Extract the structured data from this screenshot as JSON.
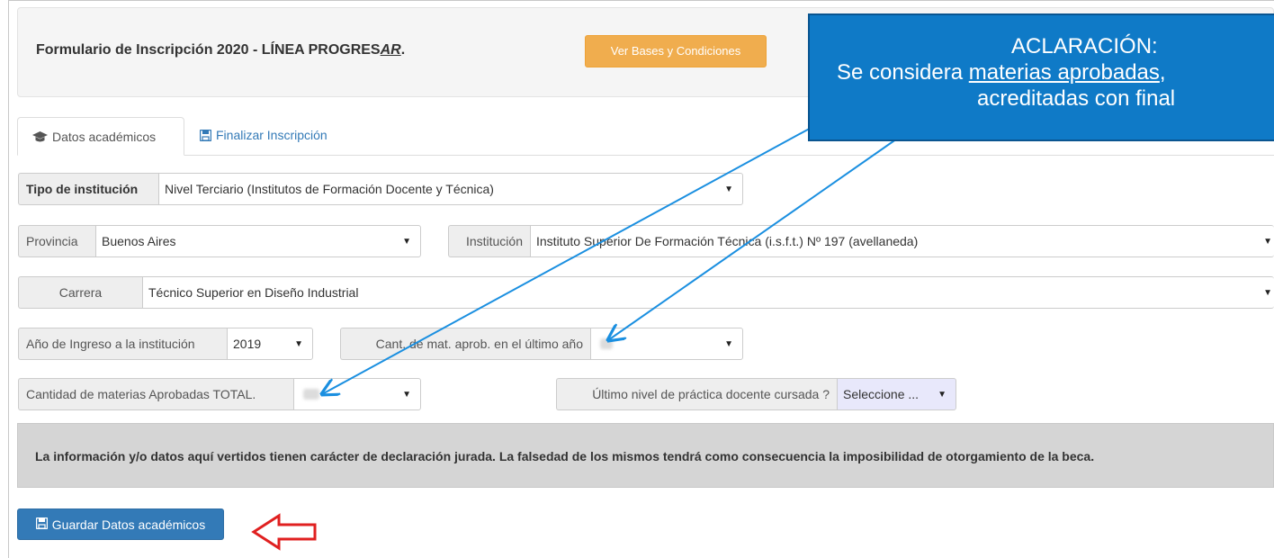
{
  "header": {
    "title_prefix": "Formulario de Inscripción 2020 - LÍNEA PROGRES",
    "title_suffix": "AR",
    "title_end": ".",
    "bases_button": "Ver Bases y Condiciones"
  },
  "tabs": [
    {
      "label": "Datos académicos",
      "icon": "graduation-cap-icon",
      "active": true
    },
    {
      "label": "Finalizar Inscripción",
      "icon": "floppy-disk-icon",
      "active": false
    }
  ],
  "form": {
    "tipo_institucion": {
      "label": "Tipo de institución",
      "value": "Nivel Terciario (Institutos de Formación Docente y Técnica)"
    },
    "provincia": {
      "label": "Provincia",
      "value": "Buenos Aires"
    },
    "institucion": {
      "label": "Institución",
      "value": "Instituto Superior De Formación Técnica (i.s.f.t.) Nº 197 (avellaneda)"
    },
    "carrera": {
      "label": "Carrera",
      "value": "Técnico Superior en Diseño Industrial"
    },
    "anio_ingreso": {
      "label": "Año de Ingreso a la institución",
      "value": "2019"
    },
    "cant_ultimo_anio": {
      "label": "Cant. de mat. aprob. en el último año",
      "value": ""
    },
    "cant_total": {
      "label": "Cantidad de materias Aprobadas TOTAL.",
      "value": ""
    },
    "ultimo_nivel": {
      "label": "Último nivel de práctica docente cursada ?",
      "value": "Seleccione ..."
    }
  },
  "dropdown_arrow": "▼",
  "notice": "La información y/o datos aquí vertidos tienen carácter de declaración jurada. La falsedad de los mismos tendrá como consecuencia la imposibilidad de otorgamiento de la beca.",
  "save_button": "Guardar Datos académicos",
  "callout": {
    "line1": "ACLARACIÓN:",
    "line2_prefix": "Se considera ",
    "line2_underlined": "materias aprobadas",
    "line2_suffix": ",",
    "line3": "acreditadas con final"
  },
  "colors": {
    "bases_button": "#f0ad4e",
    "save_button": "#337ab7",
    "callout": "#0f7ac7",
    "arrow_blue": "#1a8fe0",
    "arrow_red": "#e02020"
  }
}
